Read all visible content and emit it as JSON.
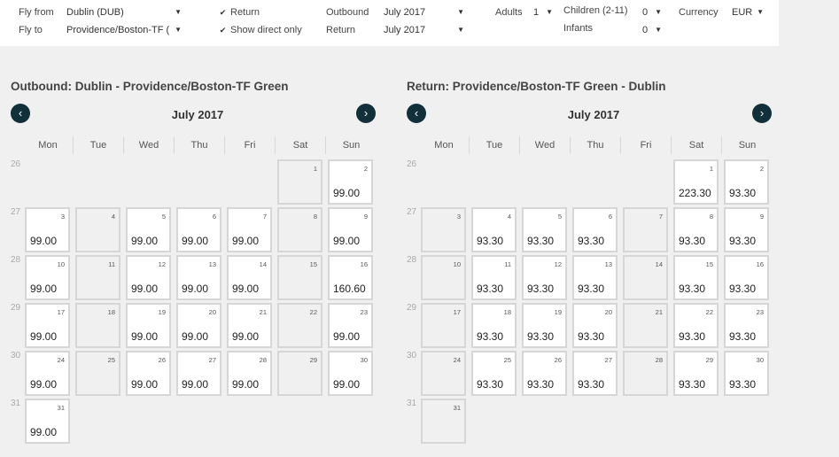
{
  "search": {
    "fly_from_label": "Fly from",
    "fly_from_value": "Dublin (DUB)",
    "fly_to_label": "Fly to",
    "fly_to_value": "Providence/Boston-TF (",
    "return_label": "Return",
    "direct_label": "Show direct only",
    "outbound_label": "Outbound",
    "outbound_value": "July 2017",
    "return_date_label": "Return",
    "return_value": "July 2017",
    "adults_label": "Adults",
    "adults_value": "1",
    "children_label": "Children (2-11)",
    "children_value": "0",
    "infants_label": "Infants",
    "infants_value": "0",
    "currency_label": "Currency",
    "currency_value": "EUR",
    "arrow": "▼",
    "check": "✔"
  },
  "weekdays": [
    "Mon",
    "Tue",
    "Wed",
    "Thu",
    "Fri",
    "Sat",
    "Sun"
  ],
  "calendars": [
    {
      "title": "Outbound:  Dublin - Providence/Boston-TF Green",
      "month": "July 2017",
      "nav_prev": "‹",
      "nav_next": "›",
      "weeks": [
        {
          "num": "26",
          "days": [
            null,
            null,
            null,
            null,
            null,
            {
              "day": "1",
              "price": ""
            },
            {
              "day": "2",
              "price": "99.00"
            }
          ]
        },
        {
          "num": "27",
          "days": [
            {
              "day": "3",
              "price": "99.00"
            },
            {
              "day": "4",
              "price": ""
            },
            {
              "day": "5",
              "price": "99.00"
            },
            {
              "day": "6",
              "price": "99.00"
            },
            {
              "day": "7",
              "price": "99.00"
            },
            {
              "day": "8",
              "price": ""
            },
            {
              "day": "9",
              "price": "99.00"
            }
          ]
        },
        {
          "num": "28",
          "days": [
            {
              "day": "10",
              "price": "99.00"
            },
            {
              "day": "11",
              "price": ""
            },
            {
              "day": "12",
              "price": "99.00"
            },
            {
              "day": "13",
              "price": "99.00"
            },
            {
              "day": "14",
              "price": "99.00"
            },
            {
              "day": "15",
              "price": ""
            },
            {
              "day": "16",
              "price": "160.60"
            }
          ]
        },
        {
          "num": "29",
          "days": [
            {
              "day": "17",
              "price": "99.00"
            },
            {
              "day": "18",
              "price": ""
            },
            {
              "day": "19",
              "price": "99.00"
            },
            {
              "day": "20",
              "price": "99.00"
            },
            {
              "day": "21",
              "price": "99.00"
            },
            {
              "day": "22",
              "price": ""
            },
            {
              "day": "23",
              "price": "99.00"
            }
          ]
        },
        {
          "num": "30",
          "days": [
            {
              "day": "24",
              "price": "99.00"
            },
            {
              "day": "25",
              "price": ""
            },
            {
              "day": "26",
              "price": "99.00"
            },
            {
              "day": "27",
              "price": "99.00"
            },
            {
              "day": "28",
              "price": "99.00"
            },
            {
              "day": "29",
              "price": ""
            },
            {
              "day": "30",
              "price": "99.00"
            }
          ]
        },
        {
          "num": "31",
          "days": [
            {
              "day": "31",
              "price": "99.00"
            },
            null,
            null,
            null,
            null,
            null,
            null
          ]
        }
      ]
    },
    {
      "title": "Return:  Providence/Boston-TF Green - Dublin",
      "month": "July 2017",
      "nav_prev": "‹",
      "nav_next": "›",
      "weeks": [
        {
          "num": "26",
          "days": [
            null,
            null,
            null,
            null,
            null,
            {
              "day": "1",
              "price": "223.30"
            },
            {
              "day": "2",
              "price": "93.30"
            }
          ]
        },
        {
          "num": "27",
          "days": [
            {
              "day": "3",
              "price": ""
            },
            {
              "day": "4",
              "price": "93.30"
            },
            {
              "day": "5",
              "price": "93.30"
            },
            {
              "day": "6",
              "price": "93.30"
            },
            {
              "day": "7",
              "price": ""
            },
            {
              "day": "8",
              "price": "93.30"
            },
            {
              "day": "9",
              "price": "93.30"
            }
          ]
        },
        {
          "num": "28",
          "days": [
            {
              "day": "10",
              "price": ""
            },
            {
              "day": "11",
              "price": "93.30"
            },
            {
              "day": "12",
              "price": "93.30"
            },
            {
              "day": "13",
              "price": "93.30"
            },
            {
              "day": "14",
              "price": ""
            },
            {
              "day": "15",
              "price": "93.30"
            },
            {
              "day": "16",
              "price": "93.30"
            }
          ]
        },
        {
          "num": "29",
          "days": [
            {
              "day": "17",
              "price": ""
            },
            {
              "day": "18",
              "price": "93.30"
            },
            {
              "day": "19",
              "price": "93.30"
            },
            {
              "day": "20",
              "price": "93.30"
            },
            {
              "day": "21",
              "price": ""
            },
            {
              "day": "22",
              "price": "93.30"
            },
            {
              "day": "23",
              "price": "93.30"
            }
          ]
        },
        {
          "num": "30",
          "days": [
            {
              "day": "24",
              "price": ""
            },
            {
              "day": "25",
              "price": "93.30"
            },
            {
              "day": "26",
              "price": "93.30"
            },
            {
              "day": "27",
              "price": "93.30"
            },
            {
              "day": "28",
              "price": ""
            },
            {
              "day": "29",
              "price": "93.30"
            },
            {
              "day": "30",
              "price": "93.30"
            }
          ]
        },
        {
          "num": "31",
          "days": [
            {
              "day": "31",
              "price": ""
            },
            null,
            null,
            null,
            null,
            null,
            null
          ]
        }
      ]
    }
  ]
}
